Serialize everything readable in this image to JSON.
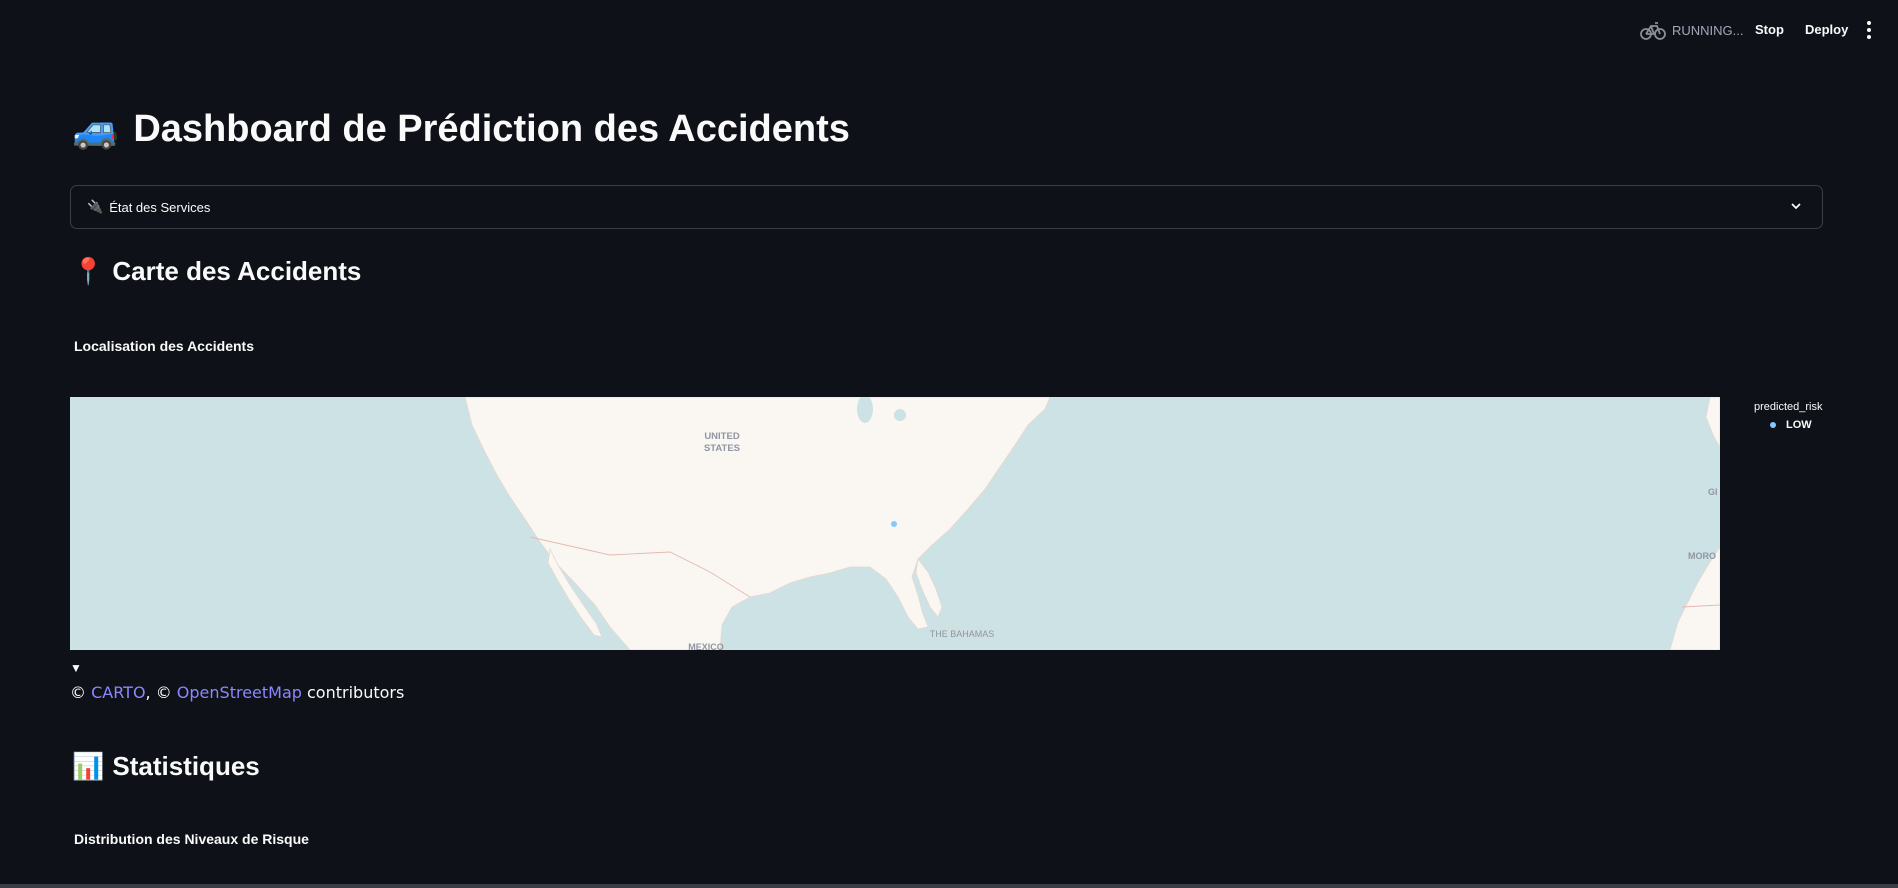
{
  "toolbar": {
    "status_text": "RUNNING...",
    "stop_label": "Stop",
    "deploy_label": "Deploy",
    "status_icon": "bicycle-icon",
    "menu_icon": "vertical-dots-icon"
  },
  "title": {
    "emoji": "🚙",
    "text": "Dashboard de Prédiction des Accidents"
  },
  "expander": {
    "emoji": "🔌",
    "label": "État des Services"
  },
  "map_section": {
    "emoji": "📍",
    "heading": "Carte des Accidents",
    "subheading": "Localisation des Accidents",
    "labels": {
      "us_line1": "UNITED",
      "us_line2": "STATES",
      "mexico": "MEXICO",
      "bahamas": "THE BAHAMAS",
      "morocco": "MORO",
      "gi": "GI"
    },
    "legend_title": "predicted_risk",
    "legend_items": [
      {
        "label": "LOW",
        "color": "#83c9ff"
      }
    ],
    "toggle_arrow": "▼",
    "attribution": {
      "prefix": "© ",
      "carto": "CARTO",
      "middle": ", © ",
      "osm": "OpenStreetMap",
      "suffix": " contributors"
    }
  },
  "stats_section": {
    "emoji": "📊",
    "heading": "Statistiques",
    "subheading": "Distribution des Niveaux de Risque"
  },
  "colors": {
    "background": "#0e1117",
    "water": "#cde2e4",
    "land": "#faf7f2",
    "link": "#8b87ff",
    "point": "#83c9ff"
  }
}
